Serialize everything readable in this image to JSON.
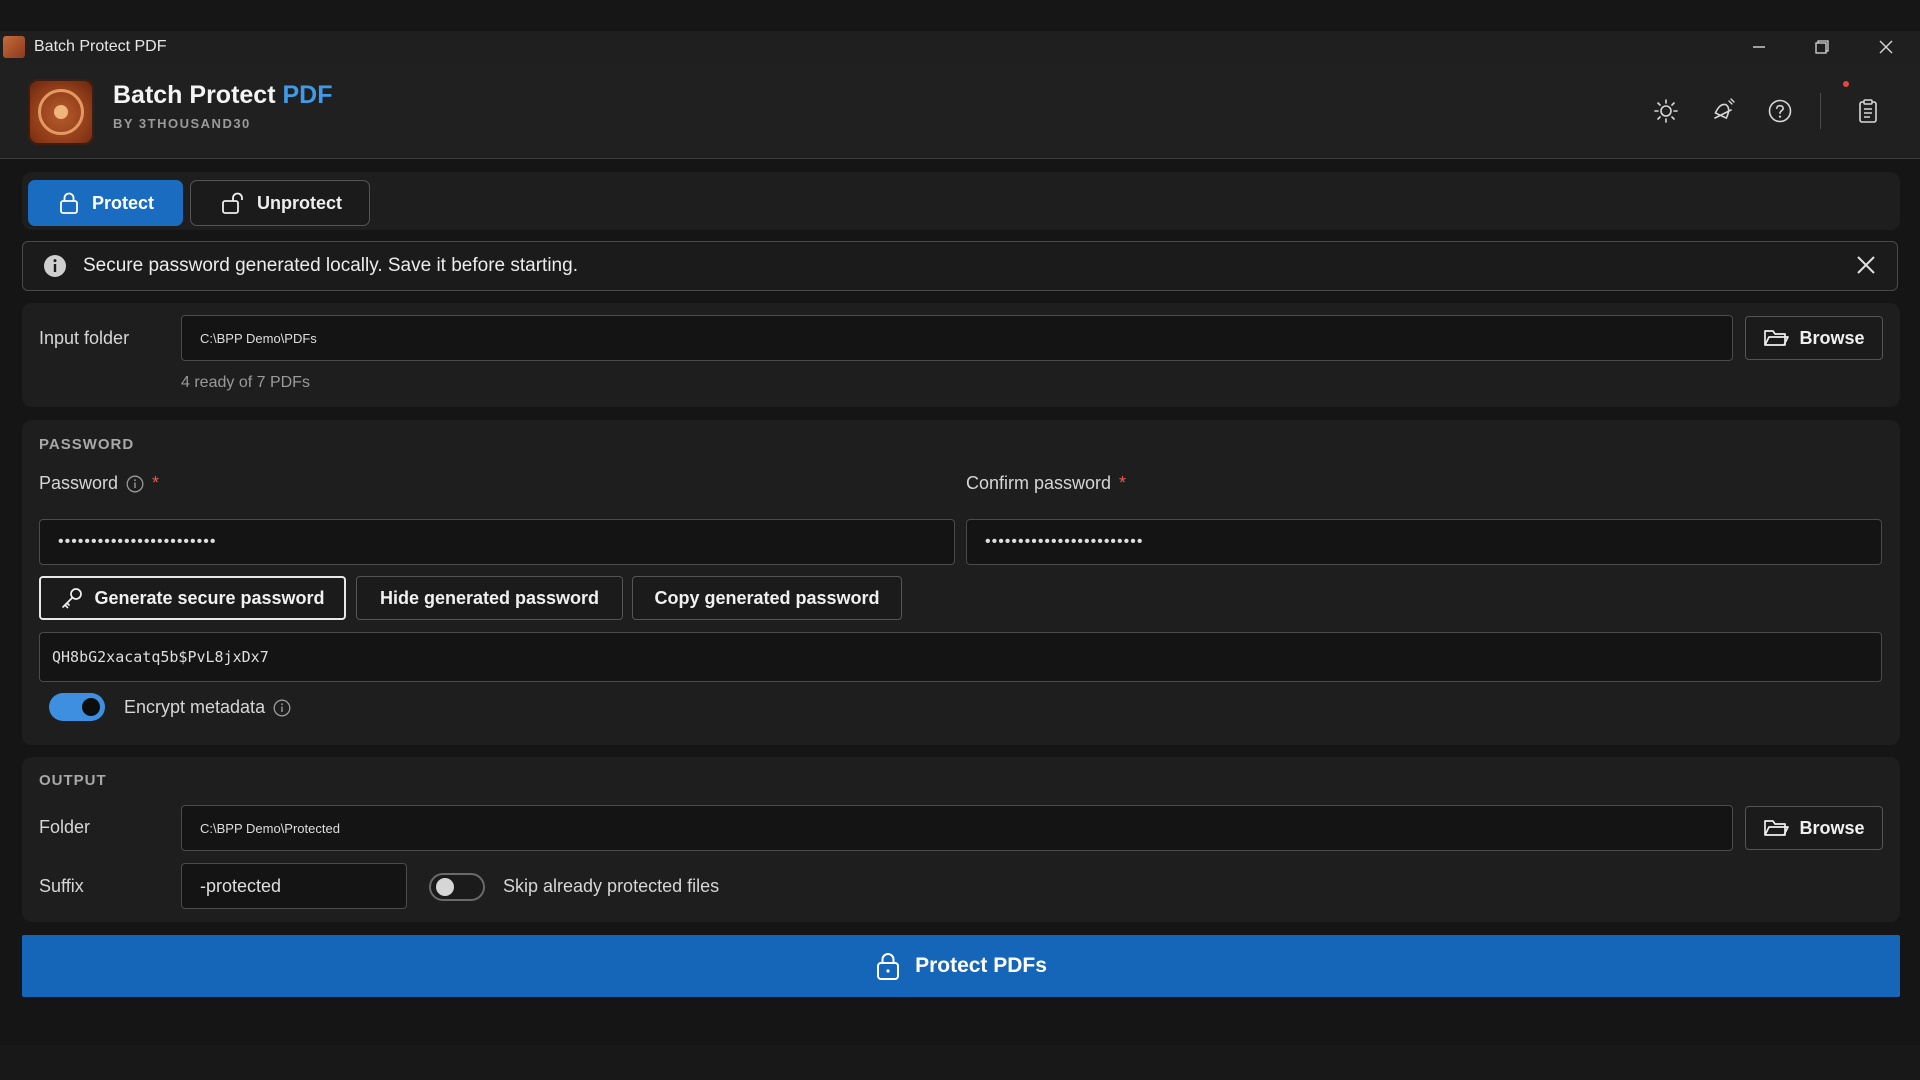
{
  "window": {
    "title": "Batch Protect PDF"
  },
  "header": {
    "brand_main": "Batch Protect",
    "brand_accent": "PDF",
    "byline": "BY 3THOUSAND30",
    "accent_color": "#3f9be8"
  },
  "tabs": [
    {
      "label": "Protect",
      "active": true
    },
    {
      "label": "Unprotect",
      "active": false
    }
  ],
  "alert": {
    "message": "Secure password generated locally. Save it before starting."
  },
  "input": {
    "label": "Input folder",
    "value": "C:\\BPP Demo\\PDFs",
    "browse_label": "Browse",
    "status": "4 ready of 7 PDFs"
  },
  "password": {
    "section_title": "PASSWORD",
    "password_label": "Password",
    "confirm_label": "Confirm password",
    "required_mark": "*",
    "password_value": "••••••••••••••••••••••••",
    "confirm_value": "••••••••••••••••••••••••",
    "generate_label": "Generate secure password",
    "hide_label": "Hide generated password",
    "copy_label": "Copy generated password",
    "generated_value": "QH8bG2xacatq5b$PvL8jxDx7",
    "encrypt_label": "Encrypt metadata",
    "encrypt_on": true
  },
  "output": {
    "section_title": "OUTPUT",
    "folder_label": "Folder",
    "folder_value": "C:\\BPP Demo\\Protected",
    "browse_label": "Browse",
    "suffix_label": "Suffix",
    "suffix_value": "-protected",
    "skip_label": "Skip already protected files",
    "skip_on": false
  },
  "action": {
    "label": "Protect PDFs",
    "color": "#1565b8"
  }
}
